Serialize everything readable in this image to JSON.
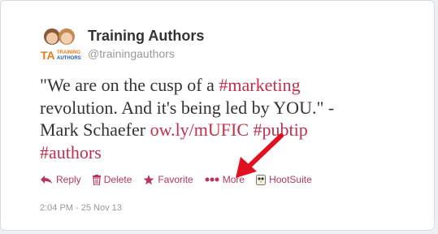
{
  "author": {
    "name": "Training Authors",
    "handle": "@trainingauthors"
  },
  "tweet": {
    "line1_plain": "\"We are on the cusp of a ",
    "line1_hashtag": "#marketing",
    "line2_plain": "revolution. And it's being led by YOU.\" -",
    "line3_plain": "Mark Schaefer ",
    "line3_link": "ow.ly/mUFIC",
    "line3_hashtag": "#pubtip",
    "line4_hashtag": "#authors"
  },
  "actions": {
    "reply": "Reply",
    "delete": "Delete",
    "favorite": "Favorite",
    "more": "More",
    "hootsuite": "HootSuite"
  },
  "timestamp": "2:04 PM - 25 Nov 13",
  "colors": {
    "link": "#c0304d",
    "action": "#b5365a",
    "arrow": "#e01020"
  },
  "icons": [
    "avatar-logo",
    "reply-icon",
    "trash-icon",
    "star-icon",
    "ellipsis-icon",
    "hootsuite-owl-icon",
    "red-arrow-annotation"
  ]
}
